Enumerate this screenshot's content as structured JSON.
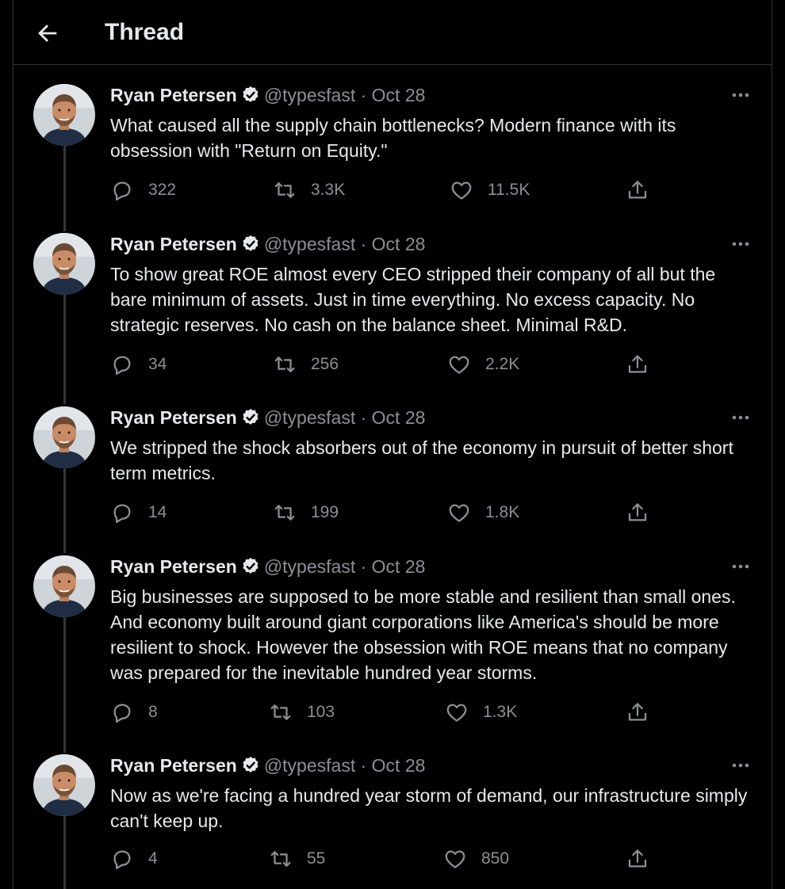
{
  "header": {
    "title": "Thread"
  },
  "author": {
    "name": "Ryan Petersen",
    "handle": "@typesfast",
    "separator": "·",
    "date": "Oct 28"
  },
  "tweets": [
    {
      "text": "What caused all the supply chain bottlenecks? Modern finance with its obsession with \"Return on Equity.\"",
      "replies": "322",
      "retweets": "3.3K",
      "likes": "11.5K"
    },
    {
      "text": "To show great ROE almost every CEO stripped their company of all but the bare minimum of assets. Just in time everything. No excess capacity. No strategic reserves. No cash on the balance sheet. Minimal R&D.",
      "replies": "34",
      "retweets": "256",
      "likes": "2.2K"
    },
    {
      "text": "We stripped the shock absorbers out of the economy in pursuit of better short term metrics.",
      "replies": "14",
      "retweets": "199",
      "likes": "1.8K"
    },
    {
      "text": "Big businesses are supposed to be more stable and resilient than small ones. And economy built around giant corporations like America's should be more resilient to shock. However the obsession with ROE means that no company was prepared for the inevitable hundred year storms.",
      "replies": "8",
      "retweets": "103",
      "likes": "1.3K"
    },
    {
      "text": "Now as we're facing a hundred year storm of demand, our infrastructure simply can't keep up.",
      "replies": "4",
      "retweets": "55",
      "likes": "850"
    }
  ],
  "icons": {
    "back": "arrow-left-icon",
    "verified": "verified-badge-icon",
    "more": "more-icon",
    "reply": "reply-icon",
    "retweet": "retweet-icon",
    "like": "heart-icon",
    "share": "share-icon"
  },
  "colors": {
    "background": "#000000",
    "text": "#e7e9ea",
    "muted": "#8b8f94",
    "divider": "#2f3336"
  }
}
